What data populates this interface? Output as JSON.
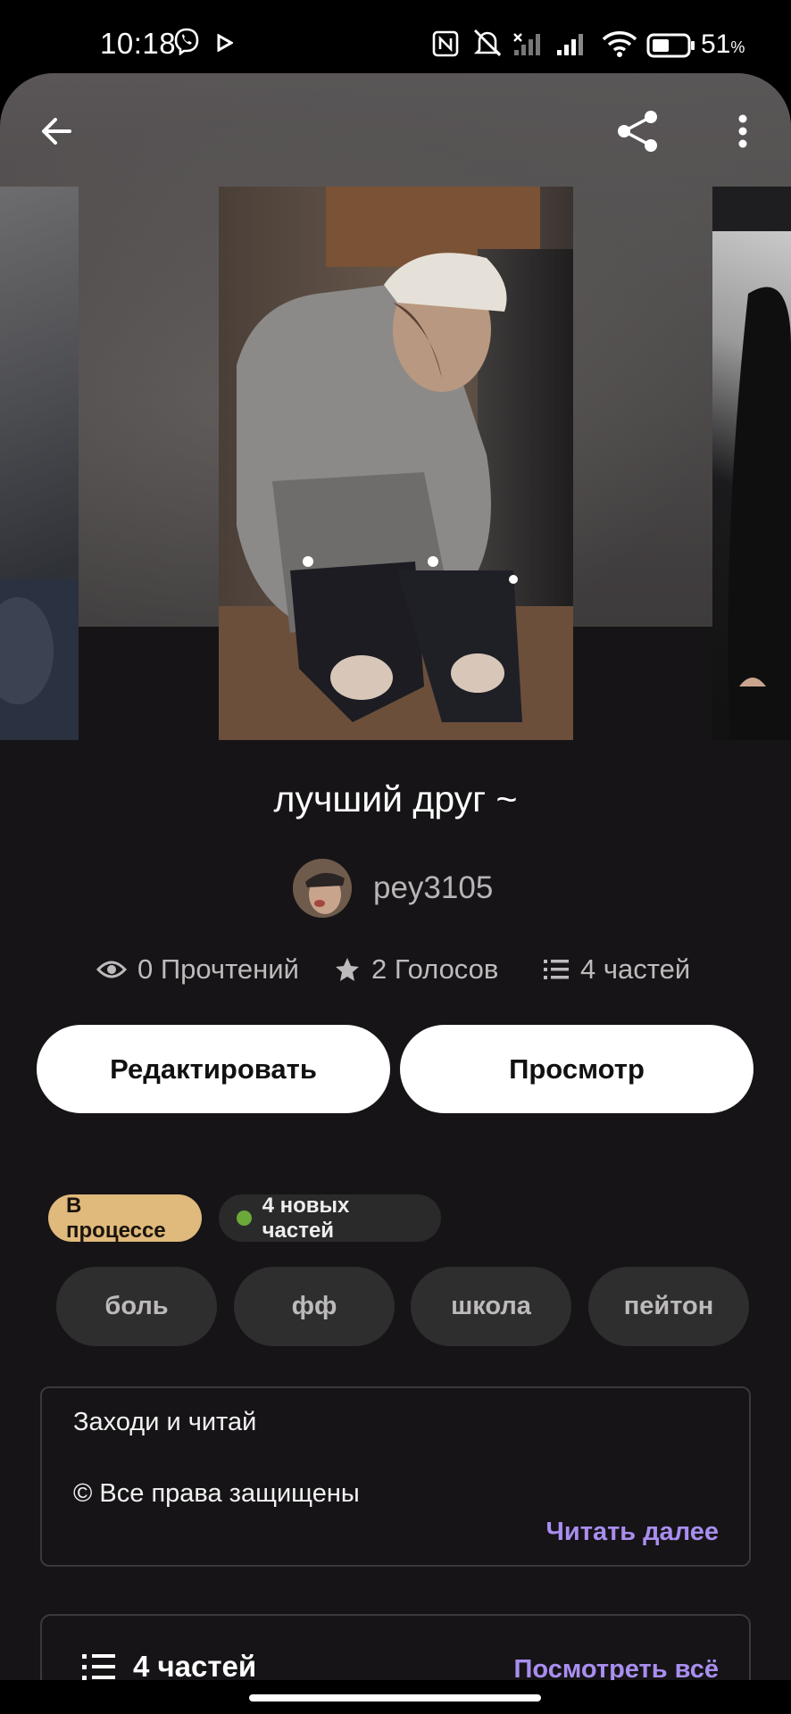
{
  "status_bar": {
    "time": "10:18",
    "battery_percent": "51",
    "battery_unit": "%",
    "battery_level": 0.51,
    "icons": [
      "viber-icon",
      "play-icon",
      "nfc-icon",
      "mute-icon",
      "signal-icon",
      "signal-icon",
      "wifi-icon",
      "battery-icon"
    ]
  },
  "header": {
    "back_icon": "arrow-left-icon",
    "share_icon": "share-icon",
    "more_icon": "more-vertical-icon"
  },
  "story": {
    "title": "лучший друг ~",
    "author": "pey3105",
    "stats": {
      "reads": "0 Прочтений",
      "votes": "2 Голосов",
      "parts": "4 частей"
    }
  },
  "actions": {
    "edit": "Редактировать",
    "preview": "Просмотр"
  },
  "badges": {
    "status": "В процессе",
    "new_parts": "4 новых частей"
  },
  "tags": [
    "боль",
    "фф",
    "школа",
    "пейтон"
  ],
  "description": {
    "line1": "Заходи и читай",
    "line2": "© Все права защищены",
    "read_more": "Читать далее"
  },
  "parts_section": {
    "title": "4 частей",
    "view_all": "Посмотреть всё"
  },
  "colors": {
    "accent": "#a98ef0",
    "status_badge": "#e0b97c",
    "new_dot": "#6ba93a",
    "background": "#161416"
  }
}
